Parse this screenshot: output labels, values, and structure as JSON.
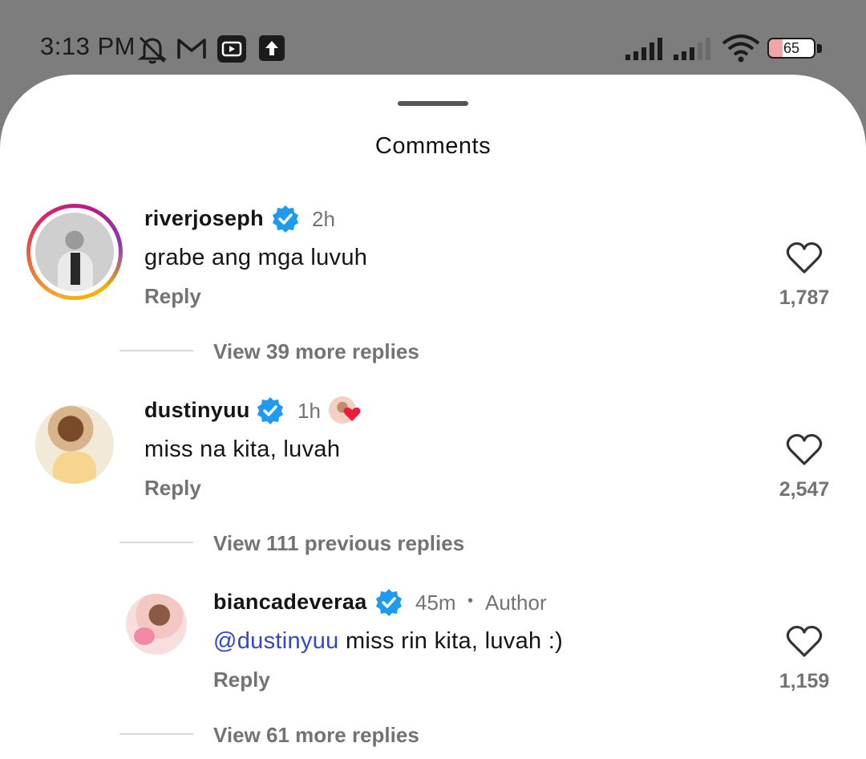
{
  "status_bar": {
    "time": "3:13 PM",
    "battery": "65",
    "icons": [
      "bell-off-icon",
      "gmail-icon",
      "video-app-icon",
      "upload-icon",
      "signal-icon",
      "signal-icon",
      "wifi-icon",
      "battery-icon"
    ]
  },
  "sheet": {
    "title": "Comments"
  },
  "comments": [
    {
      "username": "riverjoseph",
      "time": "2h",
      "text": "grabe ang mga luvuh",
      "reply_label": "Reply",
      "likes": "1,787",
      "view_replies": "View 39 more replies"
    },
    {
      "username": "dustinyuu",
      "time": "1h",
      "text": "miss na kita, luvah",
      "reply_label": "Reply",
      "likes": "2,547",
      "view_replies": "View 111 previous replies"
    },
    {
      "username": "biancadeveraa",
      "time": "45m",
      "author_label": "Author",
      "mention": "@dustinyuu",
      "text": "miss rin kita, luvah :)",
      "reply_label": "Reply",
      "likes": "1,159",
      "view_replies": "View 61 more replies"
    }
  ],
  "colors": {
    "verified": "#1d9bf0",
    "mention": "#3347c7",
    "muted": "#737373",
    "sheet": "#ffffff",
    "backdrop": "#7d7d7d"
  }
}
